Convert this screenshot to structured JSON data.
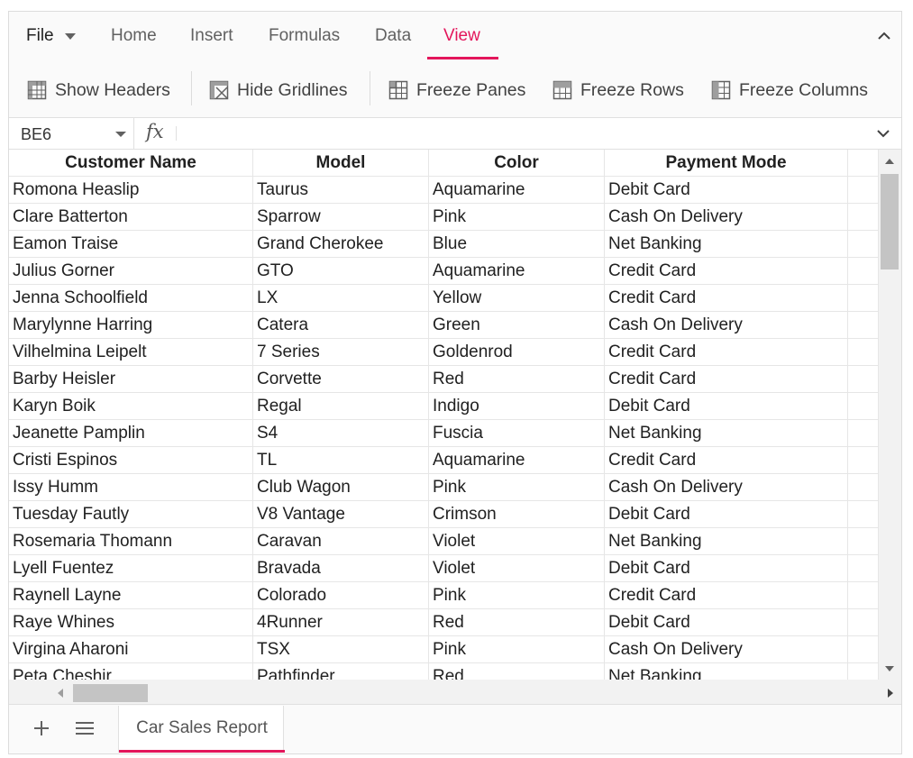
{
  "ribbon": {
    "tabs": [
      {
        "label": "File"
      },
      {
        "label": "Home"
      },
      {
        "label": "Insert"
      },
      {
        "label": "Formulas"
      },
      {
        "label": "Data"
      },
      {
        "label": "View"
      }
    ],
    "active_tab": "View",
    "accent_color": "#e3165b",
    "tools": [
      {
        "label": "Show Headers",
        "icon": "show-headers-icon"
      },
      {
        "label": "Hide Gridlines",
        "icon": "hide-gridlines-icon"
      },
      {
        "label": "Freeze Panes",
        "icon": "freeze-panes-icon"
      },
      {
        "label": "Freeze Rows",
        "icon": "freeze-rows-icon"
      },
      {
        "label": "Freeze Columns",
        "icon": "freeze-columns-icon"
      }
    ]
  },
  "formula_bar": {
    "cell_ref": "BE6",
    "fx_label": "fx",
    "value": ""
  },
  "grid": {
    "columns": [
      "Customer Name",
      "Model",
      "Color",
      "Payment Mode",
      ""
    ],
    "rows": [
      [
        "Romona Heaslip",
        "Taurus",
        "Aquamarine",
        "Debit Card"
      ],
      [
        "Clare Batterton",
        "Sparrow",
        "Pink",
        "Cash On Delivery"
      ],
      [
        "Eamon Traise",
        "Grand Cherokee",
        "Blue",
        "Net Banking"
      ],
      [
        "Julius Gorner",
        "GTO",
        "Aquamarine",
        "Credit Card"
      ],
      [
        "Jenna Schoolfield",
        "LX",
        "Yellow",
        "Credit Card"
      ],
      [
        "Marylynne Harring",
        "Catera",
        "Green",
        "Cash On Delivery"
      ],
      [
        "Vilhelmina Leipelt",
        "7 Series",
        "Goldenrod",
        "Credit Card"
      ],
      [
        "Barby Heisler",
        "Corvette",
        "Red",
        "Credit Card"
      ],
      [
        "Karyn Boik",
        "Regal",
        "Indigo",
        "Debit Card"
      ],
      [
        "Jeanette Pamplin",
        "S4",
        "Fuscia",
        "Net Banking"
      ],
      [
        "Cristi Espinos",
        "TL",
        "Aquamarine",
        "Credit Card"
      ],
      [
        "Issy Humm",
        "Club Wagon",
        "Pink",
        "Cash On Delivery"
      ],
      [
        "Tuesday Fautly",
        "V8 Vantage",
        "Crimson",
        "Debit Card"
      ],
      [
        "Rosemaria Thomann",
        "Caravan",
        "Violet",
        "Net Banking"
      ],
      [
        "Lyell Fuentez",
        "Bravada",
        "Violet",
        "Debit Card"
      ],
      [
        "Raynell Layne",
        "Colorado",
        "Pink",
        "Credit Card"
      ],
      [
        "Raye Whines",
        "4Runner",
        "Red",
        "Debit Card"
      ],
      [
        "Virgina Aharoni",
        "TSX",
        "Pink",
        "Cash On Delivery"
      ],
      [
        "Peta Cheshir",
        "Pathfinder",
        "Red",
        "Net Banking"
      ]
    ]
  },
  "sheet_tabs": {
    "active": "Car Sales Report",
    "add_icon": "plus-icon",
    "list_icon": "hamburger-menu-icon"
  }
}
